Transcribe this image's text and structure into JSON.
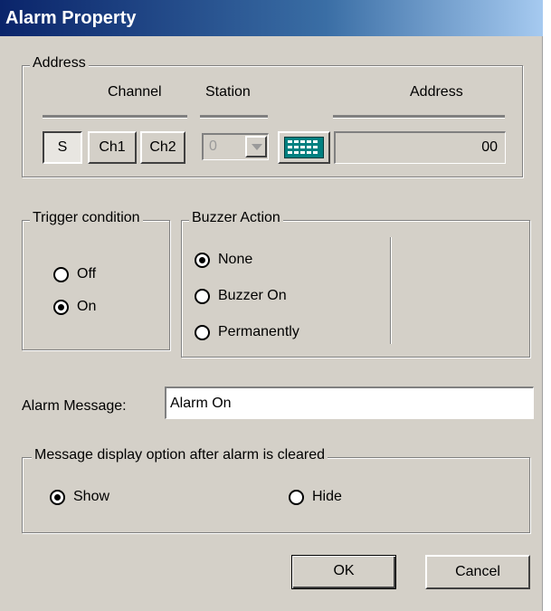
{
  "window": {
    "title": "Alarm Property"
  },
  "address_group": {
    "legend": "Address",
    "channel_header": "Channel",
    "station_header": "Station",
    "address_header": "Address",
    "channel_buttons": [
      "S",
      "Ch1",
      "Ch2"
    ],
    "selected_channel": "S",
    "station_value": "0",
    "address_value": "00",
    "keypad_icon": "keypad-icon"
  },
  "trigger_group": {
    "legend": "Trigger condition",
    "options": [
      "Off",
      "On"
    ],
    "selected": "On"
  },
  "buzzer_group": {
    "legend": "Buzzer Action",
    "options": [
      "None",
      "Buzzer On",
      "Permanently"
    ],
    "selected": "None"
  },
  "alarm_message": {
    "label": "Alarm Message:",
    "value": "Alarm On"
  },
  "display_group": {
    "legend": "Message display option after alarm is cleared",
    "options": [
      "Show",
      "Hide"
    ],
    "selected": "Show"
  },
  "buttons": {
    "ok": "OK",
    "cancel": "Cancel"
  },
  "colors": {
    "dialog_bg": "#d4d0c8",
    "title_start": "#0a246a",
    "title_end": "#a6caf0",
    "keypad": "#008080"
  }
}
